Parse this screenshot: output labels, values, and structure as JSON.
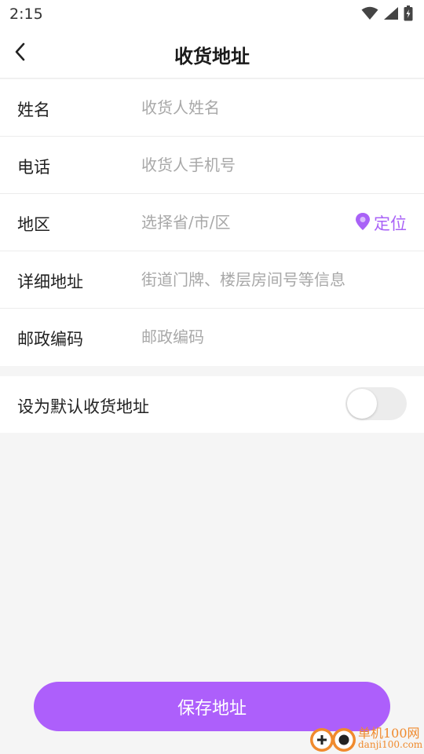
{
  "status_bar": {
    "time": "2:15",
    "icons": [
      "wifi-icon",
      "signal-icon",
      "battery-icon"
    ]
  },
  "nav": {
    "back_icon": "chevron-left-icon",
    "title": "收货地址"
  },
  "form": {
    "name": {
      "label": "姓名",
      "placeholder": "收货人姓名",
      "value": ""
    },
    "phone": {
      "label": "电话",
      "placeholder": "收货人手机号",
      "value": ""
    },
    "region": {
      "label": "地区",
      "placeholder": "选择省/市/区",
      "value": "",
      "locate_label": "定位",
      "locate_icon": "location-pin-icon"
    },
    "detail": {
      "label": "详细地址",
      "placeholder": "街道门牌、楼层房间号等信息",
      "value": ""
    },
    "postcode": {
      "label": "邮政编码",
      "placeholder": "邮政编码",
      "value": ""
    }
  },
  "default_address": {
    "label": "设为默认收货地址",
    "enabled": false
  },
  "save_button": {
    "label": "保存地址"
  },
  "watermark": {
    "brand": "单机100网",
    "url": "danji100.com"
  },
  "colors": {
    "accent": "#ad5ffb",
    "locate": "#a962f7",
    "background": "#f5f5f5",
    "toggle_off": "#ececec"
  }
}
